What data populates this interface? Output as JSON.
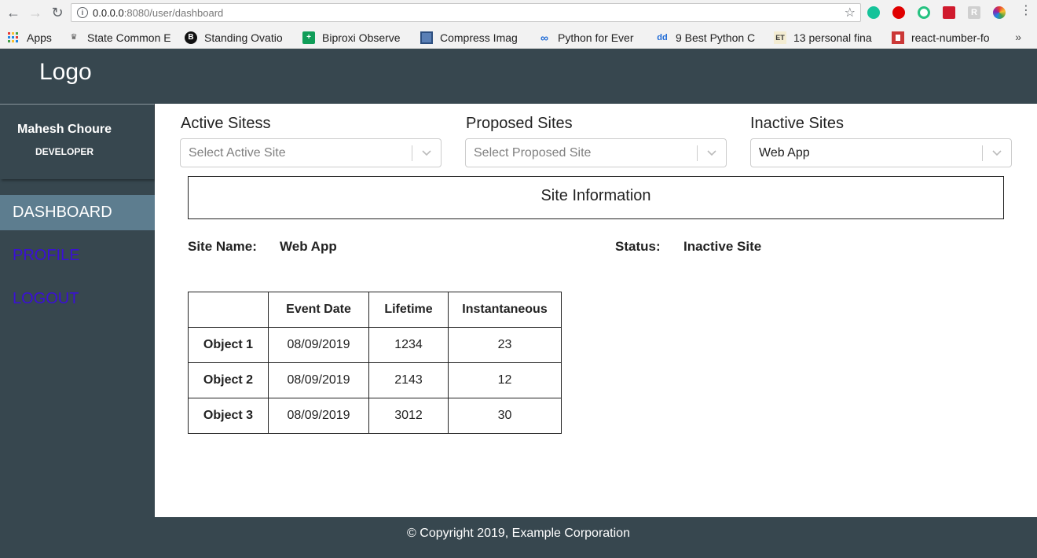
{
  "browser": {
    "url_host": "0.0.0.0",
    "url_path": ":8080/user/dashboard",
    "bookmarks": [
      {
        "label": "Apps",
        "icon": "apps-grid-icon"
      },
      {
        "label": "State Common E",
        "icon": "emblem-icon"
      },
      {
        "label": "Standing Ovatio",
        "icon": "circle-b-icon"
      },
      {
        "label": "Biproxi Observe",
        "icon": "green-plus-icon"
      },
      {
        "label": "Compress Imag",
        "icon": "monitor-icon"
      },
      {
        "label": "Python for Ever",
        "icon": "infinity-icon"
      },
      {
        "label": "9 Best Python C",
        "icon": "dd-icon"
      },
      {
        "label": "13 personal fina",
        "icon": "et-icon"
      },
      {
        "label": "react-number-fo",
        "icon": "npm-icon"
      }
    ],
    "more_label": "»"
  },
  "header": {
    "logo": "Logo"
  },
  "sidebar": {
    "user_name": "Mahesh Choure",
    "user_role": "DEVELOPER",
    "items": [
      {
        "label": "DASHBOARD"
      },
      {
        "label": "PROFILE"
      },
      {
        "label": "LOGOUT"
      }
    ]
  },
  "filters": {
    "active": {
      "label": "Active Sitess",
      "placeholder": "Select Active Site"
    },
    "proposed": {
      "label": "Proposed Sites",
      "placeholder": "Select Proposed Site"
    },
    "inactive": {
      "label": "Inactive Sites",
      "value": "Web App"
    }
  },
  "site_info": {
    "title": "Site Information",
    "name_label": "Site Name:",
    "name_value": "Web App",
    "status_label": "Status:",
    "status_value": "Inactive Site"
  },
  "table": {
    "headers": [
      "",
      "Event Date",
      "Lifetime",
      "Instantaneous"
    ],
    "rows": [
      [
        "Object 1",
        "08/09/2019",
        "1234",
        "23"
      ],
      [
        "Object 2",
        "08/09/2019",
        "2143",
        "12"
      ],
      [
        "Object 3",
        "08/09/2019",
        "3012",
        "30"
      ]
    ]
  },
  "footer": {
    "text": "© Copyright 2019, Example Corporation"
  }
}
